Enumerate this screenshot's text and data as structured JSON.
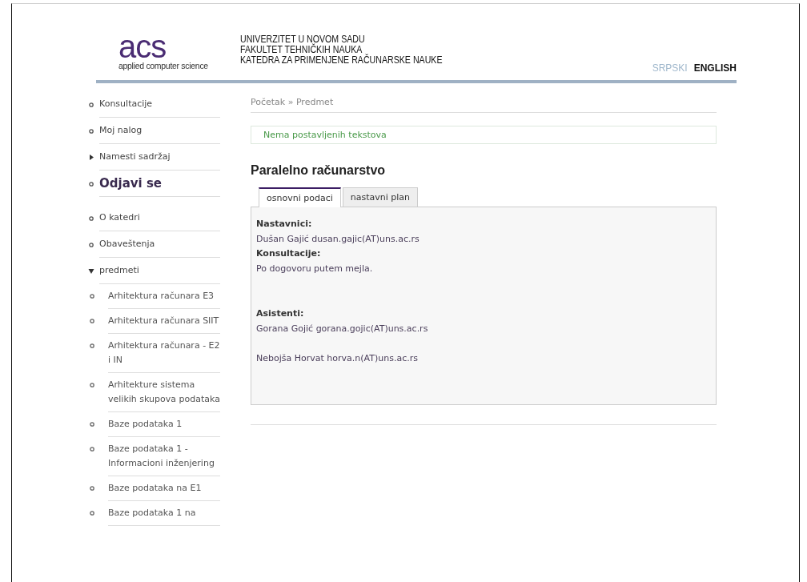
{
  "header": {
    "logo": {
      "mark": "acs",
      "tagline": "applied computer science"
    },
    "institution": [
      "UNIVERZITET U NOVOM SADU",
      "FAKULTET TEHNIČKIH NAUKA",
      "KATEDRA ZA PRIMENJENE RAČUNARSKE NAUKE"
    ],
    "languages": [
      {
        "label": "SRPSKI",
        "selected": false
      },
      {
        "label": "ENGLISH",
        "selected": true
      }
    ]
  },
  "sidebar": {
    "groups": [
      [
        {
          "label": "Konsultacije",
          "kind": "bullet"
        },
        {
          "label": "Moj nalog",
          "kind": "bullet"
        },
        {
          "label": "Namesti sadržaj",
          "kind": "collapsed"
        },
        {
          "label": "Odjavi se",
          "kind": "emphasis"
        }
      ],
      [
        {
          "label": "O katedri",
          "kind": "bullet"
        },
        {
          "label": "Obaveštenja",
          "kind": "bullet"
        },
        {
          "label": "predmeti",
          "kind": "expanded",
          "children": [
            {
              "label": "Arhitektura računara E3"
            },
            {
              "label": "Arhitektura računara SIIT"
            },
            {
              "label": "Arhitektura računara - E2 i IN"
            },
            {
              "label": "Arhitekture sistema velikih skupova podataka"
            },
            {
              "label": "Baze podataka 1"
            },
            {
              "label": "Baze podataka 1 - Informacioni inženjering"
            },
            {
              "label": "Baze podataka na E1"
            },
            {
              "label": "Baze podataka 1 na"
            }
          ]
        }
      ]
    ]
  },
  "breadcrumb": "Početak » Predmet",
  "notice": "Nema postavljenih tekstova",
  "title": "Paralelno računarstvo",
  "tabs": [
    {
      "label": "osnovni podaci",
      "selected": true
    },
    {
      "label": "nastavni plan",
      "selected": false
    }
  ],
  "panel": [
    {
      "heading": "Nastavnici:",
      "lines": [
        "Dušan Gajić dusan.gajic(AT)uns.ac.rs"
      ]
    },
    {
      "heading": "Konsultacije:",
      "lines": [
        "Po dogovoru putem mejla."
      ]
    },
    {
      "heading": "Asistenti:",
      "lines": [
        "Gorana Gojić gorana.gojic(AT)uns.ac.rs",
        "Nebojša Horvat horva.n(AT)uns.ac.rs"
      ]
    }
  ]
}
